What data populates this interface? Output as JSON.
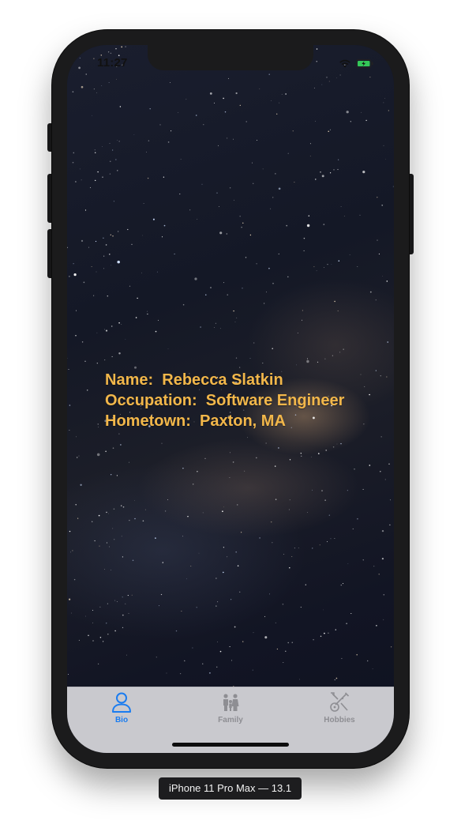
{
  "status_bar": {
    "time": "11:27"
  },
  "bio": {
    "name_line": "Name:  Rebecca Slatkin",
    "occupation_line": "Occupation:  Software Engineer",
    "hometown_line": "Hometown:  Paxton, MA"
  },
  "tab_bar": {
    "tabs": [
      {
        "label": "Bio",
        "icon": "person-icon",
        "active": true
      },
      {
        "label": "Family",
        "icon": "family-icon",
        "active": false
      },
      {
        "label": "Hobbies",
        "icon": "hobbies-icon",
        "active": false
      }
    ]
  },
  "device": {
    "label": "iPhone 11 Pro Max — 13.1"
  },
  "colors": {
    "bio_text": "#f2b74a",
    "tab_active": "#1a7cf0",
    "tab_inactive": "#8e8e93",
    "tab_bar_bg": "#c9c9ce",
    "battery": "#34c759"
  }
}
